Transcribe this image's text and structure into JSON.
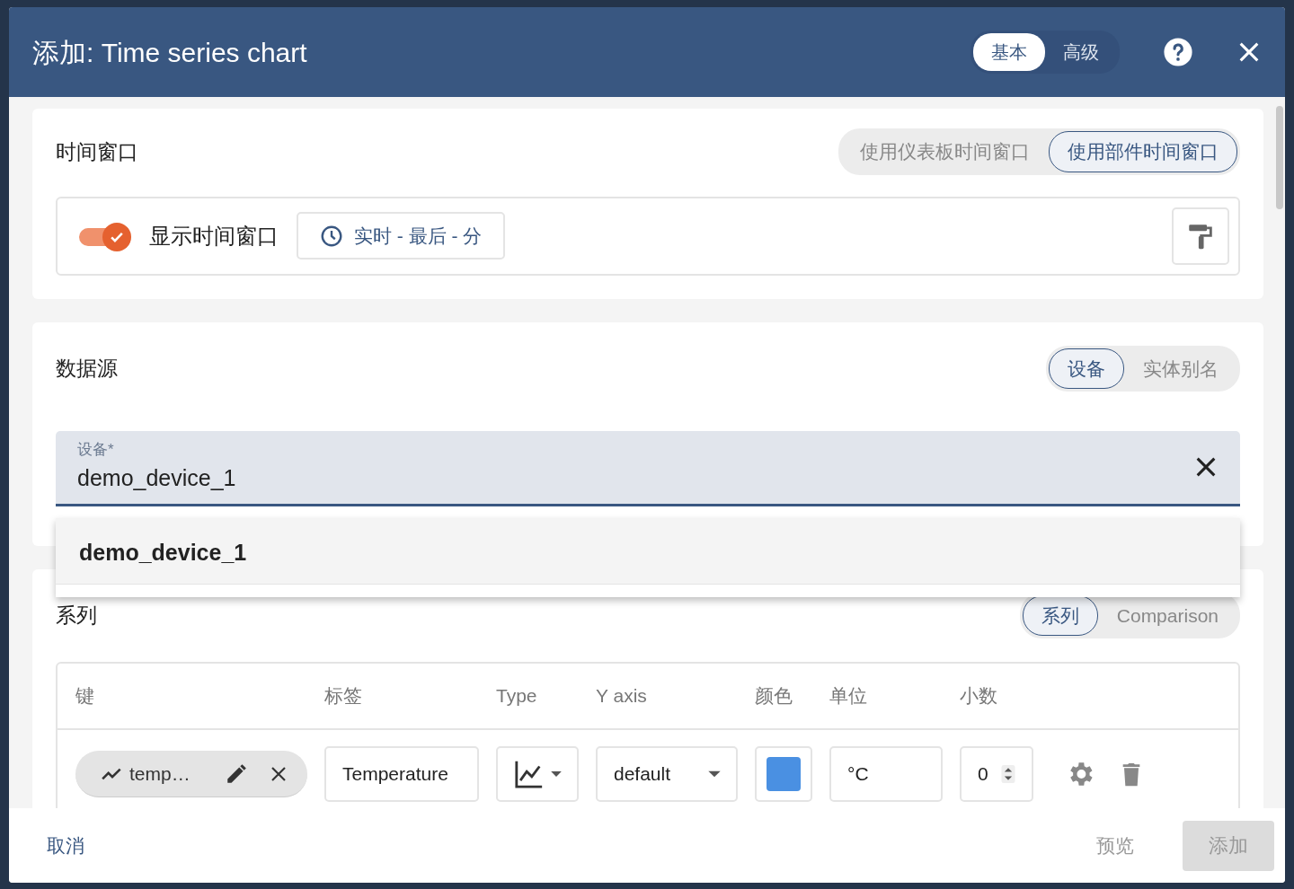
{
  "dialog": {
    "title": "添加: Time series chart",
    "mode_toggle": [
      {
        "label": "基本",
        "selected": true
      },
      {
        "label": "高级",
        "selected": false
      }
    ]
  },
  "time_window": {
    "title": "时间窗口",
    "options": [
      {
        "label": "使用仪表板时间窗口",
        "selected": false
      },
      {
        "label": "使用部件时间窗口",
        "selected": true
      }
    ],
    "show_toggle": {
      "label": "显示时间窗口",
      "on": true
    },
    "interval_button": "实时 - 最后 - 分"
  },
  "datasource": {
    "title": "数据源",
    "options": [
      {
        "label": "设备",
        "selected": true
      },
      {
        "label": "实体别名",
        "selected": false
      }
    ],
    "device_field": {
      "label": "设备*",
      "value": "demo_device_1"
    },
    "autocomplete": [
      {
        "label": "demo_device_1"
      }
    ]
  },
  "series": {
    "title": "系列",
    "options": [
      {
        "label": "系列",
        "selected": true
      },
      {
        "label": "Comparison",
        "selected": false
      }
    ],
    "columns": [
      "键",
      "标签",
      "Type",
      "Y axis",
      "颜色",
      "单位",
      "小数"
    ],
    "rows": [
      {
        "key": "temp…",
        "label": "Temperature",
        "y_axis": "default",
        "color": "#4a90e2",
        "units": "°C",
        "decimals": "0"
      }
    ]
  },
  "footer": {
    "cancel": "取消",
    "preview": "预览",
    "add": "添加",
    "add_disabled": true
  }
}
